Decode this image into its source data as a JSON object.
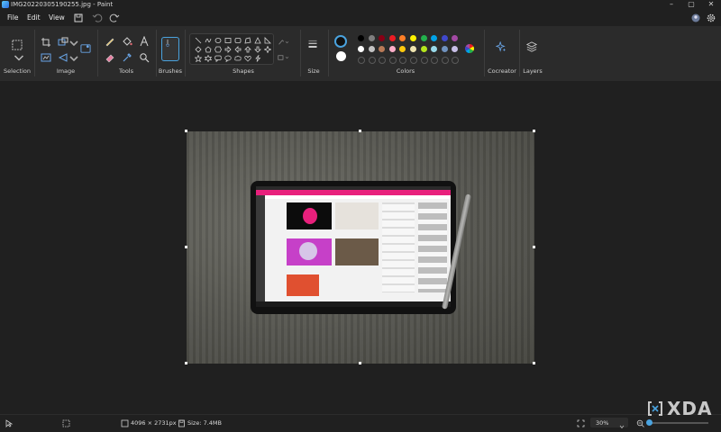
{
  "window": {
    "title": "IMG20220305190255.jpg - Paint"
  },
  "menu": {
    "file": "File",
    "edit": "Edit",
    "view": "View"
  },
  "ribbon": {
    "groups": {
      "selection": "Selection",
      "image": "Image",
      "tools": "Tools",
      "brushes": "Brushes",
      "shapes": "Shapes",
      "size": "Size",
      "colors": "Colors",
      "cocreator": "Cocreator",
      "layers": "Layers"
    }
  },
  "colors": {
    "color1": "#111111",
    "color2": "#ffffff",
    "row1": [
      "#000000",
      "#7f7f7f",
      "#880015",
      "#ed1c24",
      "#ff7f27",
      "#fff200",
      "#22b14c",
      "#00a2e8",
      "#3f48cc",
      "#a349a4"
    ],
    "row2": [
      "#ffffff",
      "#c3c3c3",
      "#b97a57",
      "#ffaec9",
      "#ffc90e",
      "#efe4b0",
      "#b5e61d",
      "#99d9ea",
      "#7092be",
      "#c8bfe7"
    ],
    "accent": "#4aa3df"
  },
  "status": {
    "dimensions": "4096 × 2731px",
    "size": "Size: 7.4MB",
    "zoom": "30%",
    "zoom_fraction": 0.3
  },
  "watermark": {
    "text": "XDA"
  }
}
